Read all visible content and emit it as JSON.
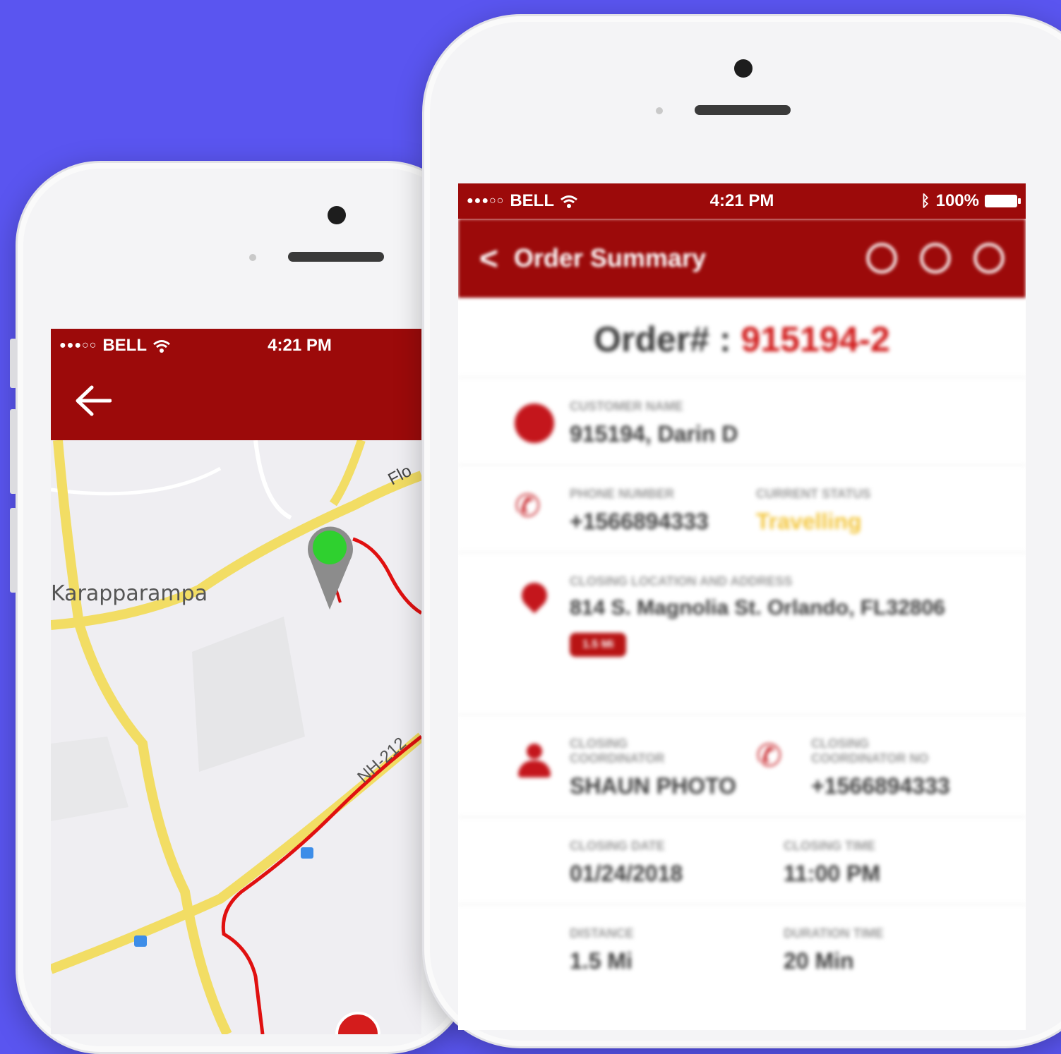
{
  "left_phone": {
    "status_bar": {
      "signal": "●●●○○",
      "carrier": "BELL",
      "time": "4:21 PM"
    },
    "back_icon": "back-arrow-icon",
    "map": {
      "place_label": "Karapparampa",
      "road_label_top": "Flo",
      "highway_label": "NH-212",
      "colors": {
        "road": "#f6e56a",
        "route": "#e01010",
        "pin_start": "#2fd02f"
      }
    }
  },
  "right_phone": {
    "status_bar": {
      "signal": "●●●○○",
      "carrier": "BELL",
      "time": "4:21 PM",
      "battery": "100%"
    },
    "app_bar": {
      "title": "Order Summary",
      "actions": [
        "refresh-icon",
        "power-icon",
        "settings-icon"
      ]
    },
    "order": {
      "prefix": "Order# :",
      "number": "915194-2"
    },
    "fields": {
      "customer_label": "CUSTOMER NAME",
      "customer_value": "915194, Darin D",
      "phone_label": "PHONE NUMBER",
      "phone_value": "+1566894333",
      "status_label": "CURRENT STATUS",
      "status_value": "Travelling",
      "location_label": "CLOSING LOCATION AND ADDRESS",
      "location_value": "814 S. Magnolia St. Orlando, FL32806",
      "location_tag": "1.5 Mi",
      "coordinator_label": "CLOSING COORDINATOR",
      "coordinator_value": "SHAUN PHOTO",
      "coordinator_phone_label": "CLOSING COORDINATOR NO",
      "coordinator_phone_value": "+1566894333",
      "date_label": "CLOSING DATE",
      "date_value": "01/24/2018",
      "time_label": "CLOSING TIME",
      "time_value": "11:00 PM",
      "distance_label": "DISTANCE",
      "distance_value": "1.5 Mi",
      "duration_label": "DURATION TIME",
      "duration_value": "20 Min"
    },
    "colors": {
      "brand": "#9c0a0a",
      "accent": "#c4161c",
      "status": "#f3c53a"
    }
  },
  "background_color": "#5a55f0"
}
